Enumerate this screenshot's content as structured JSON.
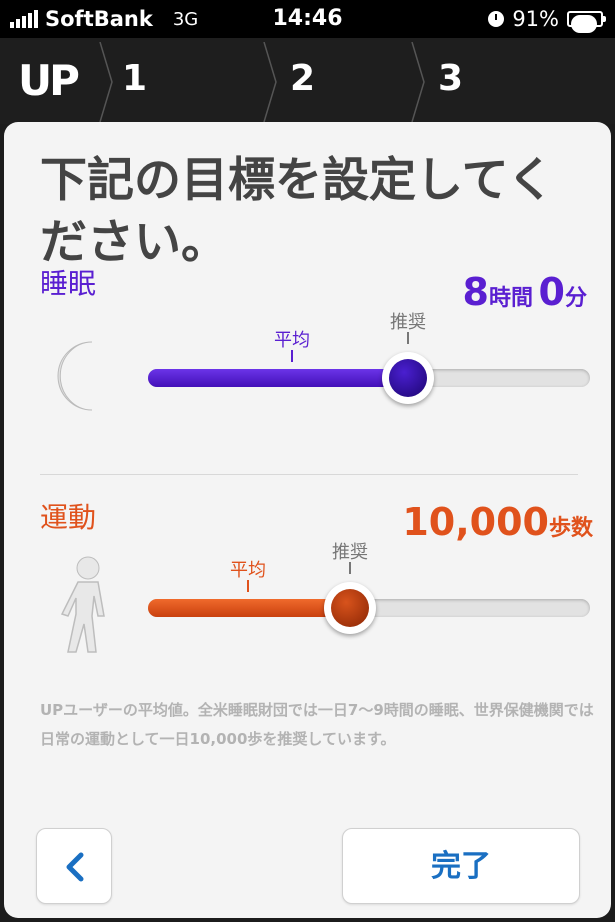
{
  "status_bar": {
    "carrier": "SoftBank",
    "network": "3G",
    "time": "14:46",
    "battery": "91%",
    "battery_level": 0.91
  },
  "nav": {
    "logo": "UP",
    "steps": [
      "1",
      "2",
      "3"
    ]
  },
  "title": "下記の目標を設定してください。",
  "sleep": {
    "label": "睡眠",
    "hours": "8",
    "hours_unit": "時間",
    "minutes": "0",
    "minutes_unit": "分",
    "average_label": "平均",
    "recommended_label": "推奨",
    "color": "#5a1fd1",
    "icon": "moon-icon"
  },
  "activity": {
    "label": "運動",
    "steps_value": "10,000",
    "steps_unit": "歩数",
    "average_label": "平均",
    "recommended_label": "推奨",
    "color": "#e0521c",
    "icon": "walking-person-icon"
  },
  "note": "UPユーザーの平均値。全米睡眠財団では一日7〜9時間の睡眠、世界保健機関では日常の運動として一日10,000歩を推奨しています。",
  "buttons": {
    "back_icon": "chevron-left-icon",
    "done_label": "完了"
  }
}
